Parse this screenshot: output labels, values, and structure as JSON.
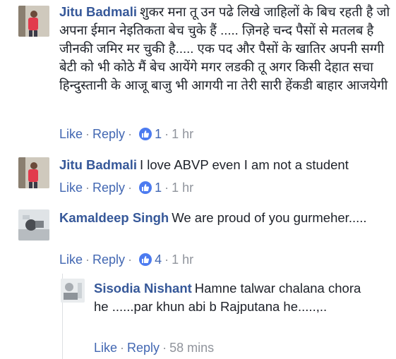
{
  "comments": [
    {
      "author": "Jitu Badmali",
      "text": "शुकर मना तू उन पढे लिखे जाहिलों के बिच रहती है जो अपना ईमान नेइतिकता बेच चुके हैं ..... ज़िनहे चन्द पैसों से मतलब है जीनकी जमिर मर चुकी है..... एक पद और पैसों के खातिर अपनी सग्गी बेटी को भी कोठे मैं बेच आयेंगे मगर लडकी तू अगर किसी देहात सचा हिन्दुस्तानी के आजू बाजु भी आगयी ना तेरी सारी हेंकडी बाहार आजयेगी",
      "like_label": "Like",
      "reply_label": "Reply",
      "likes": "1",
      "time": "1 hr"
    },
    {
      "author": "Jitu Badmali",
      "text": "I love ABVP even I am not a student",
      "like_label": "Like",
      "reply_label": "Reply",
      "likes": "1",
      "time": "1 hr"
    },
    {
      "author": "Kamaldeep Singh",
      "text": "We are proud of you gurmeher.....",
      "like_label": "Like",
      "reply_label": "Reply",
      "likes": "4",
      "time": "1 hr"
    },
    {
      "author": "Sisodia Nishant",
      "text": "Hamne talwar chalana chora he ......par khun abi b Rajputana he.....,..",
      "like_label": "Like",
      "reply_label": "Reply",
      "time": "58 mins"
    }
  ],
  "colors": {
    "name": "#365899",
    "link": "#4267b2",
    "meta": "#90949c",
    "like_badge": "#4c7bf0"
  },
  "icons": {
    "like_badge": "thumbs-up-icon"
  }
}
